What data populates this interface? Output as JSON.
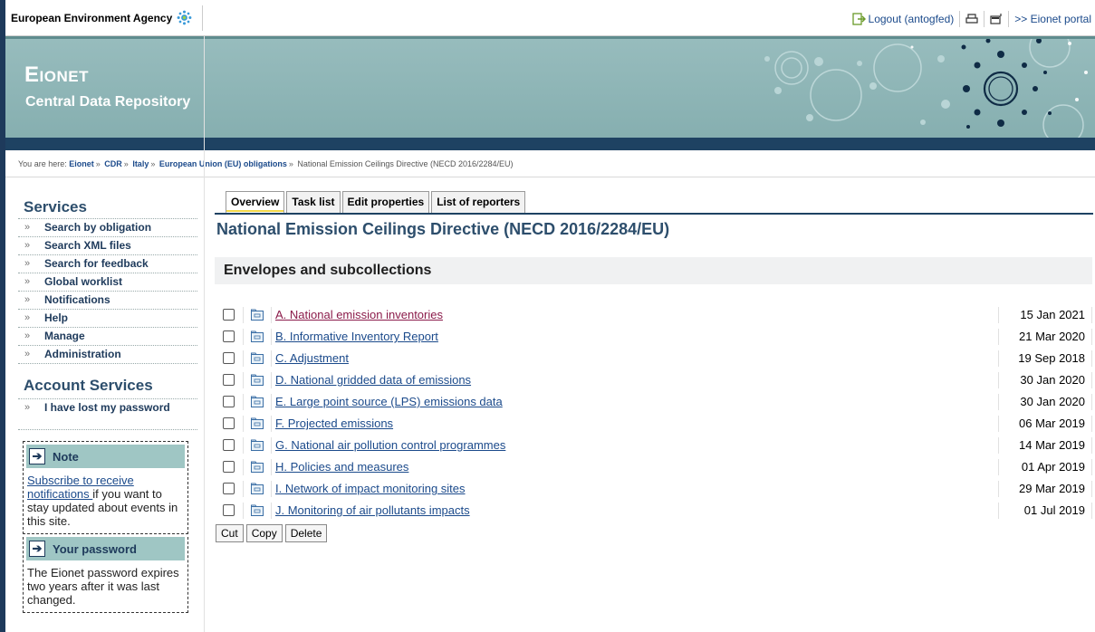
{
  "topbar": {
    "agency": "European Environment Agency",
    "logout": "Logout (antogfed)",
    "portal": ">> Eionet portal"
  },
  "banner": {
    "title": "Eionet",
    "subtitle": "Central Data Repository"
  },
  "breadcrumb": {
    "prefix": "You are here:",
    "items": [
      "Eionet",
      "CDR",
      "Italy",
      "European Union (EU) obligations",
      "National Emission Ceilings Directive (NECD 2016/2284/EU)"
    ],
    "separator": "»"
  },
  "sidebar": {
    "services_heading": "Services",
    "items": [
      {
        "label": "Search by obligation"
      },
      {
        "label": "Search XML files"
      },
      {
        "label": "Search for feedback"
      },
      {
        "label": "Global worklist"
      },
      {
        "label": "Notifications"
      },
      {
        "label": "Help"
      },
      {
        "label": "Manage"
      },
      {
        "label": "Administration"
      }
    ],
    "account_heading": "Account Services",
    "account_items": [
      {
        "label": "I have lost my password"
      }
    ],
    "note": {
      "title": "Note",
      "link": "Subscribe to receive notifications ",
      "text": "if you want to stay updated about events in this site."
    },
    "password": {
      "title": "Your password",
      "text": "The Eionet password expires two years after it was last changed."
    }
  },
  "tabs": [
    {
      "label": "Overview",
      "active": true
    },
    {
      "label": "Task list",
      "active": false
    },
    {
      "label": "Edit properties",
      "active": false
    },
    {
      "label": "List of reporters",
      "active": false
    }
  ],
  "main": {
    "title": "National Emission Ceilings Directive (NECD 2016/2284/EU)",
    "section_heading": "Envelopes and subcollections",
    "rows": [
      {
        "label": "A. National emission inventories",
        "date": "15 Jan 2021",
        "visited": true
      },
      {
        "label": "B. Informative Inventory Report",
        "date": "21 Mar 2020",
        "visited": false
      },
      {
        "label": "C. Adjustment",
        "date": "19 Sep 2018",
        "visited": false
      },
      {
        "label": "D. National gridded data of emissions",
        "date": "30 Jan 2020",
        "visited": false
      },
      {
        "label": "E. Large point source (LPS) emissions data",
        "date": "30 Jan 2020",
        "visited": false
      },
      {
        "label": "F. Projected emissions",
        "date": "06 Mar 2019",
        "visited": false
      },
      {
        "label": "G. National air pollution control programmes",
        "date": "14 Mar 2019",
        "visited": false
      },
      {
        "label": "H. Policies and measures",
        "date": "01 Apr 2019",
        "visited": false
      },
      {
        "label": "I. Network of impact monitoring sites",
        "date": "29 Mar 2019",
        "visited": false
      },
      {
        "label": "J. Monitoring of air pollutants impacts",
        "date": "01 Jul 2019",
        "visited": false
      }
    ],
    "actions": {
      "cut": "Cut",
      "copy": "Copy",
      "delete": "Delete"
    }
  },
  "colors": {
    "brand_dark": "#1e4262",
    "banner": "#8fb7b8",
    "link": "#1b4a8b",
    "visited_link": "#8b1b4a"
  }
}
